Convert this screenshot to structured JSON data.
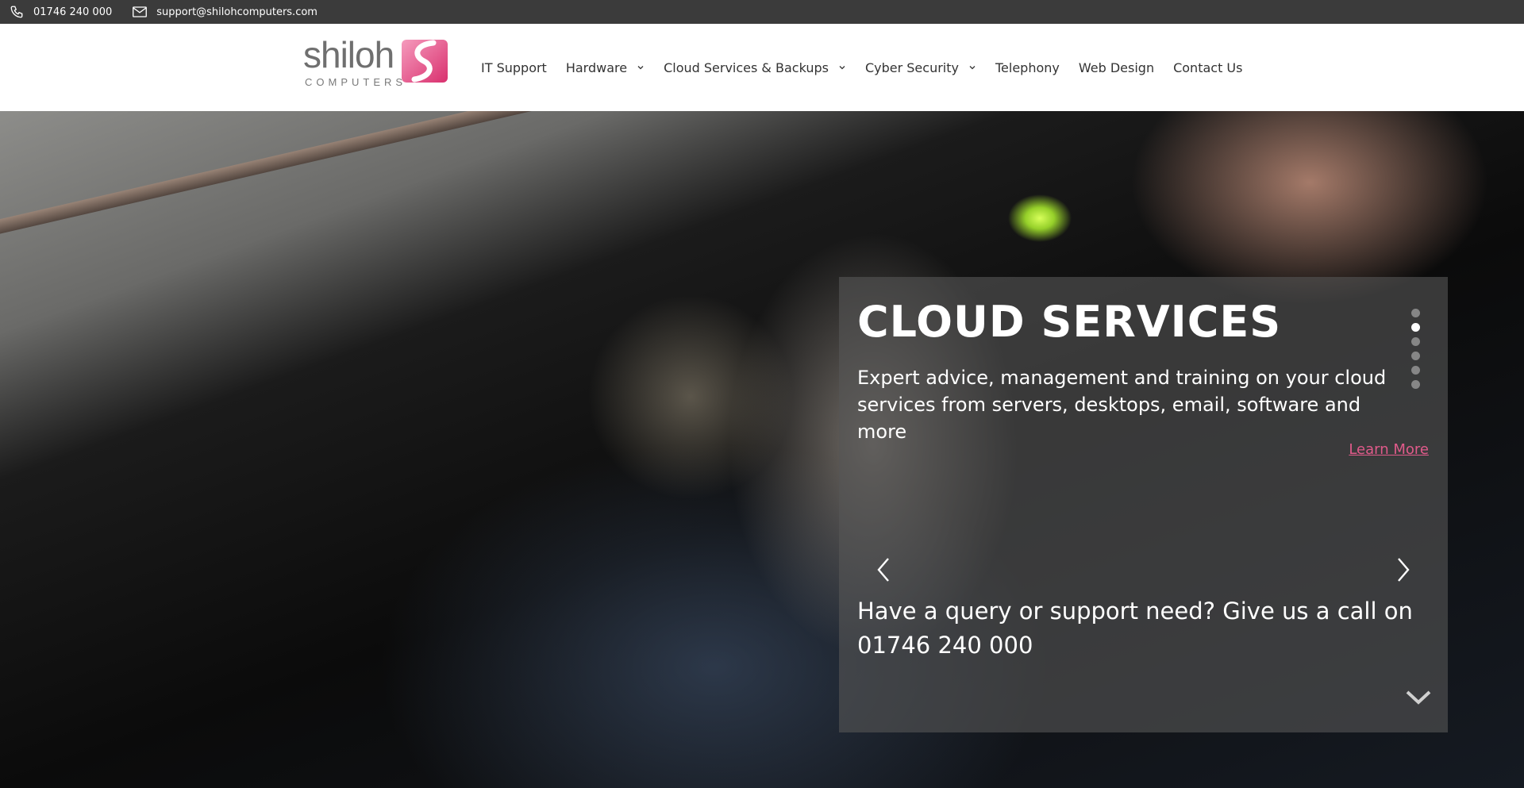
{
  "topbar": {
    "phone": "01746 240 000",
    "email": "support@shilohcomputers.com",
    "phone_icon": "phone-icon",
    "email_icon": "envelope-icon"
  },
  "logo": {
    "word": "shiloh",
    "sub": "COMPUTERS",
    "brand_color": "#e0457f"
  },
  "nav": [
    {
      "label": "IT Support",
      "dropdown": false
    },
    {
      "label": "Hardware",
      "dropdown": true
    },
    {
      "label": "Cloud Services & Backups",
      "dropdown": true
    },
    {
      "label": "Cyber Security",
      "dropdown": true
    },
    {
      "label": "Telephony",
      "dropdown": false
    },
    {
      "label": "Web Design",
      "dropdown": false
    },
    {
      "label": "Contact Us",
      "dropdown": false
    }
  ],
  "hero": {
    "title": "CLOUD SERVICES",
    "text": "Expert advice, management and training on your cloud services from servers, desktops, email, software and more",
    "learn_more": "Learn More",
    "query": "Have a query or support need? Give us a call on 01746 240 000",
    "slides_total": 6,
    "active_slide": 1,
    "link_color": "#e05a8a"
  }
}
